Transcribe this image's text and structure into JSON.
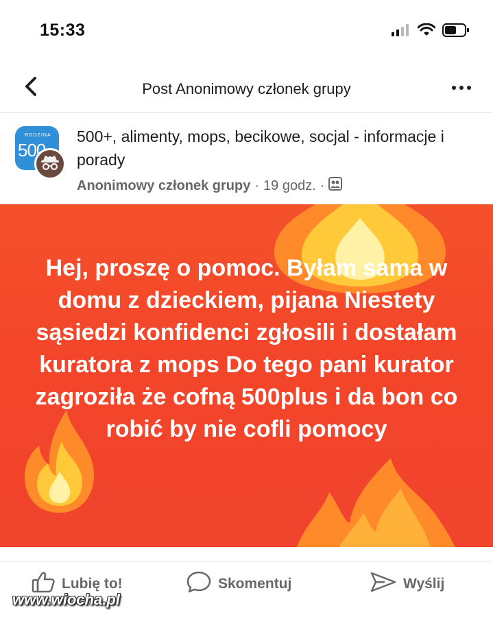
{
  "status_bar": {
    "time": "15:33"
  },
  "nav": {
    "title": "Post Anonimowy członek grupy"
  },
  "post": {
    "group_name": "500+, alimenty, mops, becikowe, socjal - informacje i porady",
    "group_avatar_text": "500",
    "group_avatar_small_text": "RODZINA",
    "author": "Anonimowy członek grupy",
    "time_ago": "19 godz.",
    "separator": "·",
    "body_text": "Hej, proszę o pomoc. Byłam sama w domu z dzieckiem, pijana Niestety sąsiedzi konfidenci zgłosili i dostałam kuratora z mops Do tego pani kurator zagroziła że cofną 500plus i da bon co robić by nie cofli pomocy",
    "background_color": "#f3452a"
  },
  "actions": {
    "like_label": "Lubię to!",
    "comment_label": "Skomentuj",
    "send_label": "Wyślij"
  },
  "icons": [
    "back-icon",
    "more-icon",
    "signal-icon",
    "wifi-icon",
    "battery-icon",
    "incognito-icon",
    "group-members-icon",
    "like-icon",
    "comment-icon",
    "send-icon",
    "flame-icon"
  ],
  "watermark": "www.wiocha.pl"
}
